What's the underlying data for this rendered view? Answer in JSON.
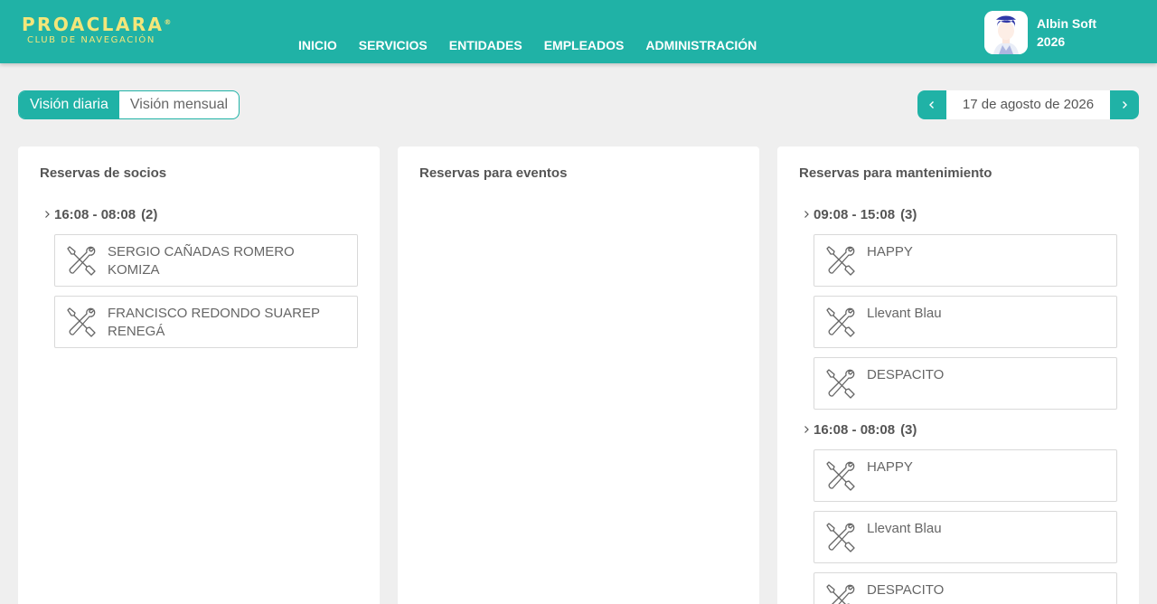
{
  "brand": {
    "name": "PROACLARA",
    "reg": "®",
    "tagline": "CLUB DE NAVEGACIÓN"
  },
  "nav": [
    "INICIO",
    "SERVICIOS",
    "ENTIDADES",
    "EMPLEADOS",
    "ADMINISTRACIÓN"
  ],
  "user": {
    "name": "Albin Soft",
    "year": "2026"
  },
  "view_toggle": {
    "daily": "Visión diaria",
    "monthly": "Visión mensual",
    "selected": "Visión diaria"
  },
  "date_nav": {
    "date": "17 de agosto de 2026",
    "prev_icon": "chevron-left-icon",
    "next_icon": "chevron-right-icon"
  },
  "colors": {
    "accent": "#20b2a6",
    "logo": "#f3e67a",
    "background": "#efefef"
  },
  "panels": [
    {
      "title": "Reservas de socios",
      "groups": [
        {
          "range": "16:08 - 08:08",
          "count": "(2)",
          "items": [
            "SERGIO CAÑADAS ROMERO KOMIZA",
            "FRANCISCO REDONDO SUAREP RENEGÁ"
          ]
        }
      ]
    },
    {
      "title": "Reservas para eventos",
      "groups": []
    },
    {
      "title": "Reservas para mantenimiento",
      "groups": [
        {
          "range": "09:08 - 15:08",
          "count": "(3)",
          "items": [
            "HAPPY",
            "Llevant Blau",
            "DESPACITO"
          ]
        },
        {
          "range": "16:08 - 08:08",
          "count": "(3)",
          "items": [
            "HAPPY",
            "Llevant Blau",
            "DESPACITO"
          ]
        }
      ]
    }
  ],
  "card_icon": "tools-icon"
}
